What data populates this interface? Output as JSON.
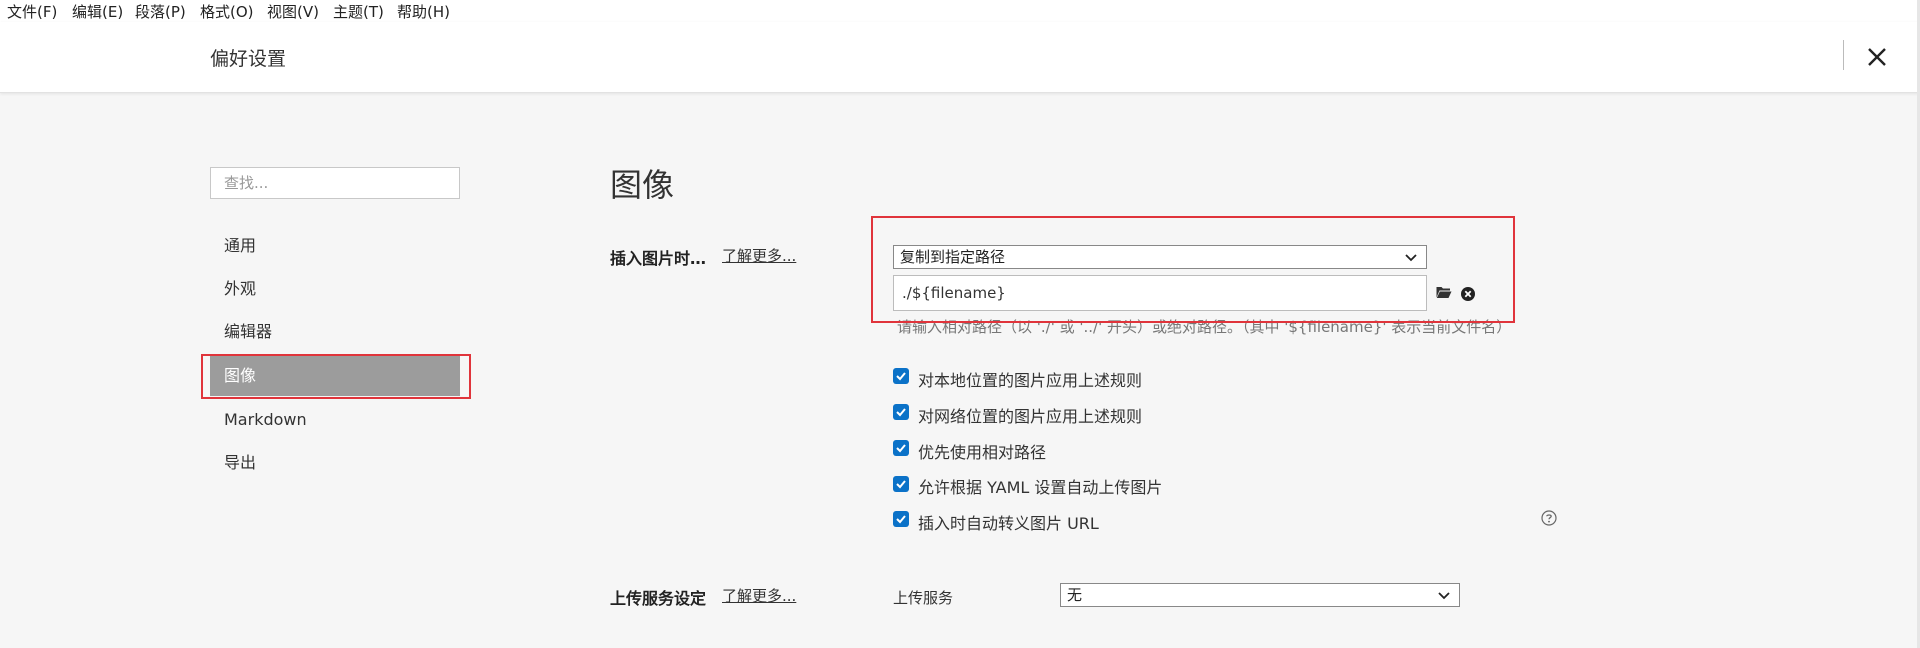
{
  "menu": [
    "文件(F)",
    "编辑(E)",
    "段落(P)",
    "格式(O)",
    "视图(V)",
    "主题(T)",
    "帮助(H)"
  ],
  "window": {
    "title": "偏好设置"
  },
  "search": {
    "placeholder": "查找..."
  },
  "nav": {
    "items": [
      "通用",
      "外观",
      "编辑器",
      "图像",
      "Markdown",
      "导出"
    ],
    "active": "图像"
  },
  "main": {
    "heading": "图像",
    "insert": {
      "label": "插入图片时…",
      "learn_more": "了解更多...",
      "action": "复制到指定路径",
      "path": "./${filename}",
      "hint": "请输入相对路径（以 './' 或 '../' 开头）或绝对路径。（其中 '${filename}' 表示当前文件名）"
    },
    "options": [
      {
        "label": "对本地位置的图片应用上述规则",
        "checked": true
      },
      {
        "label": "对网络位置的图片应用上述规则",
        "checked": true
      },
      {
        "label": "优先使用相对路径",
        "checked": true
      },
      {
        "label": "允许根据 YAML 设置自动上传图片",
        "checked": true
      },
      {
        "label": "插入时自动转义图片 URL",
        "checked": true
      }
    ],
    "upload": {
      "label": "上传服务设定",
      "learn_more": "了解更多...",
      "service_label": "上传服务",
      "service_value": "无"
    }
  },
  "icons": {
    "close": "close-icon",
    "folder": "folder-icon",
    "clear": "clear-circle-icon",
    "help": "help-circle-icon",
    "dropdown": "chevron-down-icon"
  },
  "colors": {
    "accent": "#0b72c8",
    "highlight": "#e0343b",
    "active_nav": "#9c9c9c"
  }
}
